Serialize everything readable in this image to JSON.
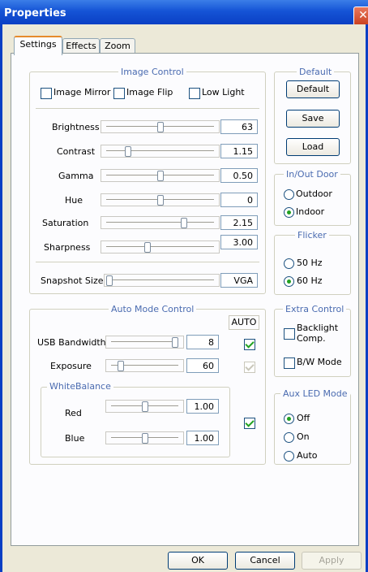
{
  "window": {
    "title": "Properties",
    "close_glyph": "✕"
  },
  "tabs": [
    {
      "label": "Settings",
      "active": true
    },
    {
      "label": "Effects",
      "active": false
    },
    {
      "label": "Zoom",
      "active": false
    }
  ],
  "image_control": {
    "title": "Image Control",
    "checkboxes": [
      {
        "label": "Image Mirror",
        "checked": false
      },
      {
        "label": "Image Flip",
        "checked": false
      },
      {
        "label": "Low Light",
        "checked": false
      }
    ],
    "sliders": [
      {
        "label": "Brightness",
        "value": "63",
        "level": 0.5
      },
      {
        "label": "Contrast",
        "value": "1.15",
        "level": 0.2
      },
      {
        "label": "Gamma",
        "value": "0.50",
        "level": 0.5
      },
      {
        "label": "Hue",
        "value": "0",
        "level": 0.5
      },
      {
        "label": "Saturation",
        "value": "2.15",
        "level": 0.72
      },
      {
        "label": "Sharpness",
        "value": "3.00",
        "level": 0.38
      }
    ],
    "snapshot": {
      "label": "Snapshot Size",
      "value": "VGA",
      "level": 0.0
    }
  },
  "default_group": {
    "title": "Default",
    "buttons": [
      "Default",
      "Save",
      "Load"
    ]
  },
  "inout_group": {
    "title": "In/Out Door",
    "options": [
      {
        "label": "Outdoor",
        "selected": false
      },
      {
        "label": "Indoor",
        "selected": true
      }
    ]
  },
  "flicker_group": {
    "title": "Flicker",
    "options": [
      {
        "label": "50 Hz",
        "selected": false
      },
      {
        "label": "60 Hz",
        "selected": true
      }
    ]
  },
  "auto_mode": {
    "title": "Auto Mode Control",
    "auto_header": "AUTO",
    "usb_bandwidth": {
      "label": "USB Bandwidth",
      "value": "8",
      "level": 0.95,
      "auto": true
    },
    "exposure": {
      "label": "Exposure",
      "value": "60",
      "level": 0.15,
      "auto": true
    },
    "white_balance": {
      "title": "WhiteBalance",
      "red": {
        "label": "Red",
        "value": "1.00",
        "level": 0.5
      },
      "blue": {
        "label": "Blue",
        "value": "1.00",
        "level": 0.5
      },
      "auto": true
    }
  },
  "extra_control": {
    "title": "Extra Control",
    "backlight_line1": "Backlight",
    "backlight_line2": "Comp.",
    "bw_mode": "B/W Mode"
  },
  "aux_led": {
    "title": "Aux LED Mode",
    "options": [
      {
        "label": "Off",
        "selected": true
      },
      {
        "label": "On",
        "selected": false
      },
      {
        "label": "Auto",
        "selected": false
      }
    ]
  },
  "footer": {
    "ok": "OK",
    "cancel": "Cancel",
    "apply": "Apply"
  },
  "colors": {
    "titlebar": "#1554d6",
    "group_title": "#4a6bb0",
    "check": "#21a121",
    "dialog_bg": "#ece9d8"
  }
}
